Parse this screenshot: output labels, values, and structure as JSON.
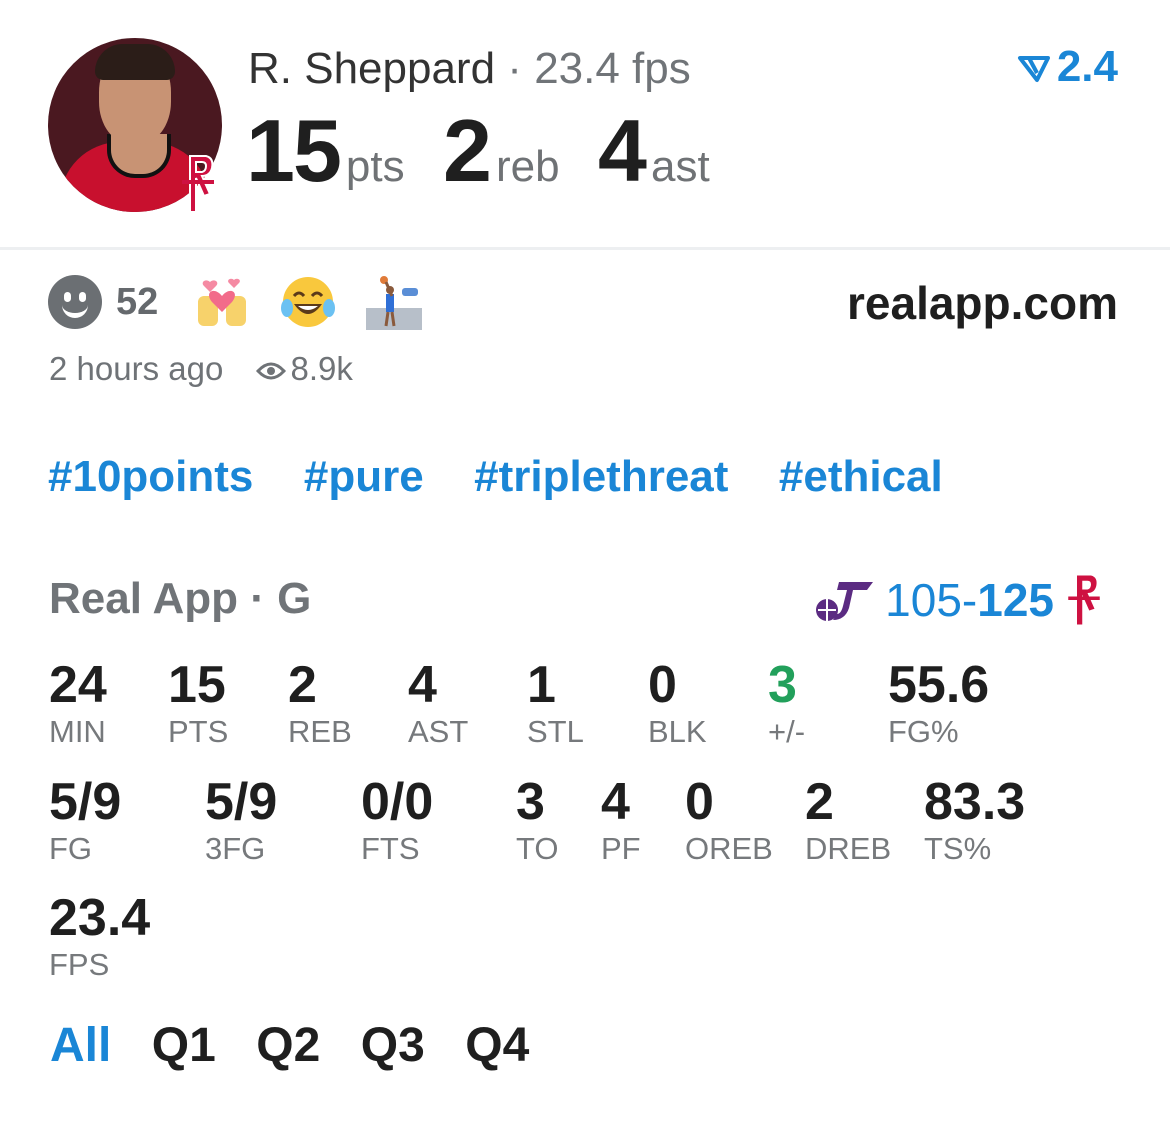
{
  "player": {
    "name": "R. Sheppard",
    "separator": "·",
    "fps_text": "23.4 fps",
    "avatar_icon": "player-headshot",
    "team_logo_icon": "rockets-logo-icon"
  },
  "headline": {
    "pts": "15",
    "pts_label": "pts",
    "reb": "2",
    "reb_label": "reb",
    "ast": "4",
    "ast_label": "ast"
  },
  "rating": {
    "icon": "rating-arrow-icon",
    "value": "2.4",
    "color": "#1a86d6"
  },
  "reactions": {
    "count": "52",
    "icons": [
      "smiley-icon",
      "hearts-emoji-icon",
      "laughing-emoji-icon",
      "player-sticker-icon"
    ]
  },
  "site": "realapp.com",
  "meta": {
    "time": "2 hours ago",
    "views": "8.9k",
    "views_icon": "eye-icon"
  },
  "hashtags": [
    "#10points",
    "#pure",
    "#triplethreat",
    "#ethical"
  ],
  "game": {
    "title": "Real App · G",
    "away_icon": "jazz-logo-icon",
    "away_score": "105",
    "dash": "-",
    "home_score": "125",
    "home_icon": "rockets-logo-icon"
  },
  "stats_row1": [
    {
      "value": "24",
      "label": "MIN"
    },
    {
      "value": "15",
      "label": "PTS"
    },
    {
      "value": "2",
      "label": "REB"
    },
    {
      "value": "4",
      "label": "AST"
    },
    {
      "value": "1",
      "label": "STL"
    },
    {
      "value": "0",
      "label": "BLK"
    },
    {
      "value": "3",
      "label": "+/-"
    },
    {
      "value": "55.6",
      "label": "FG%"
    }
  ],
  "stats_row2": [
    {
      "value": "5/9",
      "label": "FG"
    },
    {
      "value": "5/9",
      "label": "3FG"
    },
    {
      "value": "0/0",
      "label": "FTS"
    },
    {
      "value": "3",
      "label": "TO"
    },
    {
      "value": "4",
      "label": "PF"
    },
    {
      "value": "0",
      "label": "OREB"
    },
    {
      "value": "2",
      "label": "DREB"
    },
    {
      "value": "83.3",
      "label": "TS%"
    }
  ],
  "stats_row3": [
    {
      "value": "23.4",
      "label": "FPS"
    }
  ],
  "tabs": [
    "All",
    "Q1",
    "Q2",
    "Q3",
    "Q4"
  ],
  "colors": {
    "accent": "#1a86d6",
    "positive": "#22a05b",
    "rockets_red": "#ce1141",
    "jazz_purple": "#5b2b82"
  }
}
